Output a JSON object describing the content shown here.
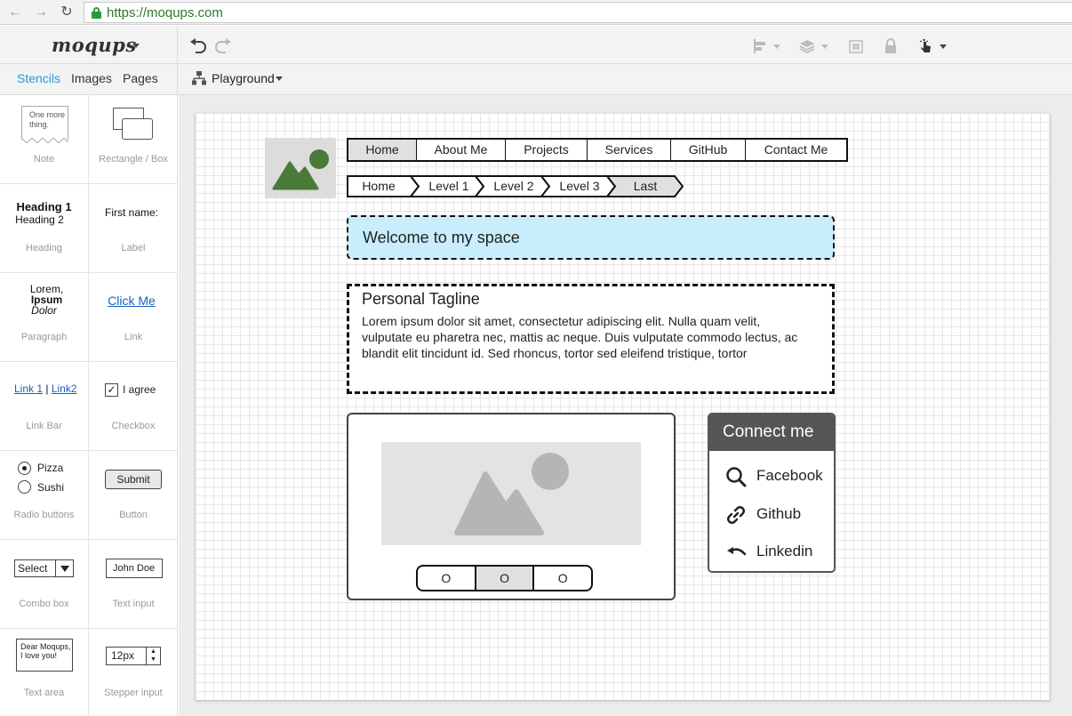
{
  "browser": {
    "url": "https://moqups.com"
  },
  "app": {
    "logo": "moqups",
    "tabs": [
      {
        "label": "Stencils",
        "active": true
      },
      {
        "label": "Images",
        "active": false
      },
      {
        "label": "Pages",
        "active": false
      }
    ],
    "page_selector": "Playground",
    "toolbar_icons": [
      "undo-icon",
      "redo-icon",
      "align-icon",
      "layers-icon",
      "group-icon",
      "lock-icon",
      "interaction-icon"
    ]
  },
  "stencils": [
    {
      "label": "Note",
      "preview": "One more thing."
    },
    {
      "label": "Rectangle / Box",
      "preview": ""
    },
    {
      "label": "Heading",
      "preview": "Heading 1",
      "preview2": "Heading 2"
    },
    {
      "label": "Label",
      "preview": "First name:"
    },
    {
      "label": "Paragraph",
      "preview": "Lorem,",
      "preview2": "Ipsum",
      "preview3": "Dolor"
    },
    {
      "label": "Link",
      "preview": "Click Me"
    },
    {
      "label": "Link Bar",
      "preview": "Link 1",
      "preview2": "Link2"
    },
    {
      "label": "Checkbox",
      "preview": "I agree"
    },
    {
      "label": "Radio buttons",
      "preview": "Pizza",
      "preview2": "Sushi"
    },
    {
      "label": "Button",
      "preview": "Submit"
    },
    {
      "label": "Combo box",
      "preview": "Select"
    },
    {
      "label": "Text input",
      "preview": "John Doe"
    },
    {
      "label": "Text area",
      "preview": "Dear Moqups, I love you!"
    },
    {
      "label": "Stepper input",
      "preview": "12px"
    }
  ],
  "wireframe": {
    "nav": [
      "Home",
      "About Me",
      "Projects",
      "Services",
      "GitHub",
      "Contact Me"
    ],
    "breadcrumbs": [
      "Home",
      "Level 1",
      "Level 2",
      "Level 3",
      "Last"
    ],
    "welcome": "Welcome to my space",
    "tagline_title": "Personal Tagline",
    "tagline_body": "Lorem ipsum dolor sit amet, consectetur adipiscing elit. Nulla quam velit, vulputate eu pharetra nec, mattis ac neque. Duis vulputate commodo lectus, ac blandit elit tincidunt id. Sed rhoncus, tortor sed eleifend tristique, tortor",
    "carousel_dots": [
      "O",
      "O",
      "O"
    ],
    "connect_title": "Connect me",
    "connect_items": [
      {
        "label": "Facebook",
        "icon": "search-icon"
      },
      {
        "label": "Github",
        "icon": "link-icon"
      },
      {
        "label": "Linkedin",
        "icon": "undo-arrow-icon"
      }
    ]
  },
  "colors": {
    "accent": "#2a9bd6",
    "welcome_bg": "#c8edfb",
    "image_green": "#4a7a38",
    "connect_header": "#555555"
  }
}
